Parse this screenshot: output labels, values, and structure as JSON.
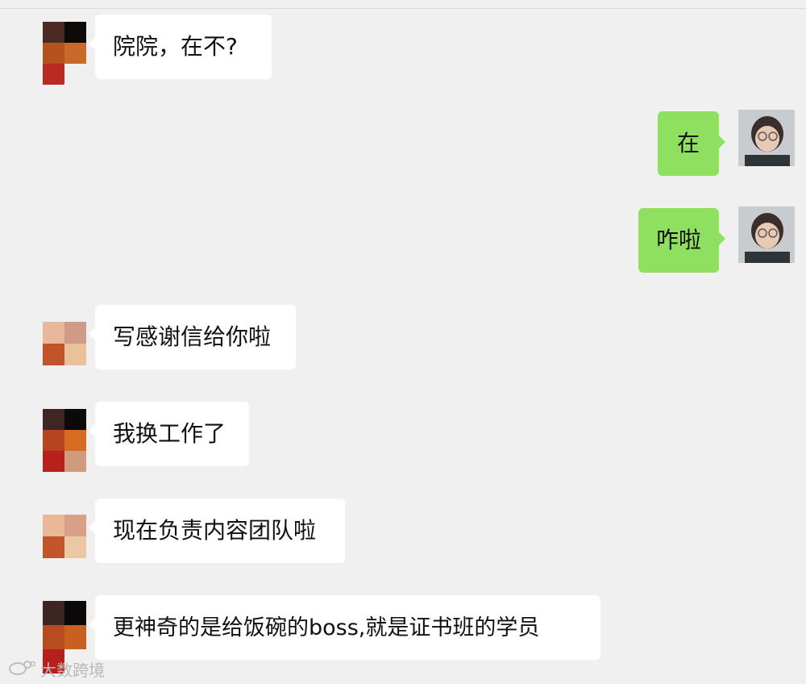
{
  "chat": {
    "messages": [
      {
        "side": "left",
        "text": "院院，在不?"
      },
      {
        "side": "right",
        "text": "在"
      },
      {
        "side": "right",
        "text": "咋啦"
      },
      {
        "side": "left",
        "text": "写感谢信给你啦"
      },
      {
        "side": "left",
        "text": "我换工作了"
      },
      {
        "side": "left",
        "text": "现在负责内容团队啦"
      },
      {
        "side": "left",
        "text": "更神奇的是给饭碗的boss,就是证书班的学员"
      }
    ]
  },
  "watermark": {
    "text": "大数跨境"
  },
  "colors": {
    "background": "#f0f0f0",
    "bubble_left": "#ffffff",
    "bubble_right": "#8fe060"
  }
}
